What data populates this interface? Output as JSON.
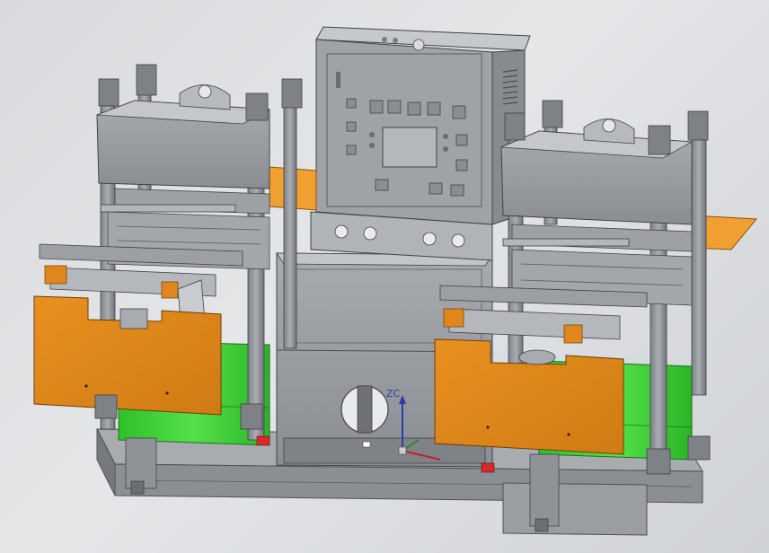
{
  "viewport": {
    "background": "#dcdee0"
  },
  "triad": {
    "z_label": "ZC",
    "z_color": "#2a3ea8",
    "y_color": "#2a8a2a",
    "x_color": "#c0202a"
  },
  "colors": {
    "steel": "#8f9499",
    "steel_dark": "#5a5f64",
    "steel_light": "#b8bcc0",
    "guard_orange": "#e0861c",
    "base_green": "#3fd23a",
    "tray_orange": "#f0a030",
    "cabinet": "#9ea2a6",
    "indicator_red": "#d42a2a"
  }
}
